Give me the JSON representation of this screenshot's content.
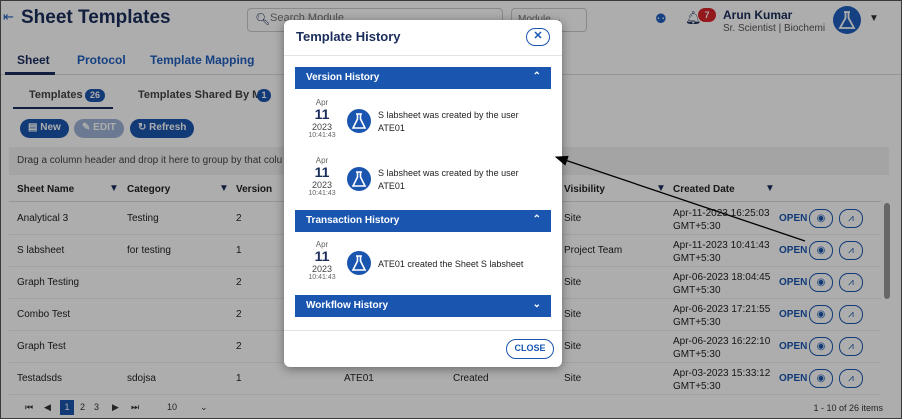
{
  "header": {
    "title": "Sheet Templates",
    "search_placeholder": "Search Module",
    "module_select": "Module",
    "notification_count": "7",
    "user_name": "Arun Kumar",
    "user_role": "Sr. Scientist | Biochemis",
    "icons": {
      "collapse": "collapse-icon",
      "search": "search-icon",
      "team": "team-icon",
      "bell": "bell-icon",
      "caret": "chevron-down-icon"
    }
  },
  "tabs": [
    {
      "label": "Sheet"
    },
    {
      "label": "Protocol"
    },
    {
      "label": "Template Mapping"
    }
  ],
  "sub_tabs": [
    {
      "label": "Templates",
      "count": "26"
    },
    {
      "label": "Templates Shared By Me",
      "count": "1"
    }
  ],
  "toolbar": {
    "new": "New",
    "edit": "EDIT",
    "refresh": "Refresh"
  },
  "group_hint": "Drag a column header and drop it here to group by that colu",
  "grid": {
    "headers": [
      "Sheet Name",
      "Category",
      "Version",
      "Visibility",
      "Created Date"
    ],
    "action_label": "OPEN",
    "rows": [
      {
        "name": "Analytical 3",
        "category": "Testing",
        "version": "2",
        "col4": "",
        "col5": "",
        "visibility": "Site",
        "date": "Apr-11-2023 16:25:03",
        "tz": "GMT+5:30"
      },
      {
        "name": "S labsheet",
        "category": "for testing",
        "version": "1",
        "col4": "",
        "col5": "",
        "visibility": "Project Team",
        "date": "Apr-11-2023 10:41:43",
        "tz": "GMT+5:30"
      },
      {
        "name": "Graph Testing",
        "category": "",
        "version": "2",
        "col4": "",
        "col5": "",
        "visibility": "Site",
        "date": "Apr-06-2023 18:04:45",
        "tz": "GMT+5:30"
      },
      {
        "name": "Combo Test",
        "category": "",
        "version": "2",
        "col4": "",
        "col5": "",
        "visibility": "Site",
        "date": "Apr-06-2023 17:21:55",
        "tz": "GMT+5:30"
      },
      {
        "name": "Graph Test",
        "category": "",
        "version": "2",
        "col4": "",
        "col5": "",
        "visibility": "Site",
        "date": "Apr-06-2023 16:22:10",
        "tz": "GMT+5:30"
      },
      {
        "name": "Testadsds",
        "category": "sdojsa",
        "version": "1",
        "col4": "ATE01",
        "col5": "Created",
        "visibility": "Site",
        "date": "Apr-03-2023 15:33:12",
        "tz": "GMT+5:30"
      }
    ]
  },
  "pager": {
    "pages": [
      "1",
      "2",
      "3"
    ],
    "page_size": "10",
    "summary": "1 - 10 of 26 items"
  },
  "modal": {
    "title": "Template History",
    "close_label": "CLOSE",
    "sections": {
      "version": "Version History",
      "transaction": "Transaction History",
      "workflow": "Workflow History"
    },
    "version_items": [
      {
        "month": "Apr",
        "day": "11",
        "year": "2023",
        "time": "10:41:43",
        "text": "S labsheet was created by the user ATE01"
      },
      {
        "month": "Apr",
        "day": "11",
        "year": "2023",
        "time": "10:41:43",
        "text": "S labsheet was created by the user ATE01"
      }
    ],
    "transaction_items": [
      {
        "month": "Apr",
        "day": "11",
        "year": "2023",
        "time": "10:41:43",
        "text": "ATE01 created the Sheet S labsheet"
      }
    ]
  },
  "colors": {
    "primary": "#1a56b0",
    "navy": "#1a2d5a",
    "badge_red": "#d9262b"
  }
}
